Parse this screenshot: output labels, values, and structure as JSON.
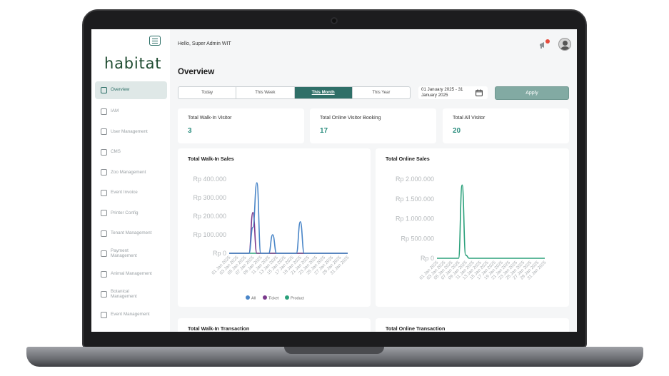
{
  "header": {
    "greeting": "Hello, Super Admin WIT",
    "notification_icon": "megaphone-icon",
    "avatar_icon": "user-avatar-icon"
  },
  "sidebar": {
    "logo": "habitat",
    "items": [
      {
        "label": "Overview",
        "icon": "grid-icon",
        "active": true
      },
      {
        "label": "IAM",
        "icon": "user-key-icon"
      },
      {
        "label": "User Management",
        "icon": "users-icon"
      },
      {
        "label": "CMS",
        "icon": "document-icon"
      },
      {
        "label": "Zoo Management",
        "icon": "paw-icon"
      },
      {
        "label": "Event Invoice",
        "icon": "invoice-icon"
      },
      {
        "label": "Printer Config",
        "icon": "printer-icon"
      },
      {
        "label": "Tenant Management",
        "icon": "store-icon"
      },
      {
        "label": "Payment Management",
        "icon": "wallet-icon"
      },
      {
        "label": "Animal Management",
        "icon": "animal-icon"
      },
      {
        "label": "Botanical Management",
        "icon": "plant-icon"
      },
      {
        "label": "Event Management",
        "icon": "ticket-icon"
      }
    ]
  },
  "main": {
    "title": "Overview",
    "filters": [
      "Today",
      "This Week",
      "This Month",
      "This Year"
    ],
    "active_filter": "This Month",
    "date_range": "01 January 2025 - 31 January 2025",
    "apply_label": "Apply"
  },
  "stats": [
    {
      "label": "Total Walk-In Visitor",
      "value": "3"
    },
    {
      "label": "Total Online Visitor Booking",
      "value": "17"
    },
    {
      "label": "Total All Visitor",
      "value": "20"
    }
  ],
  "colors": {
    "accent": "#2f6f68",
    "value_green": "#2e8f80",
    "all": "#4a86c8",
    "ticket": "#7b3a8c",
    "product": "#2aa07a"
  },
  "chart_data": [
    {
      "type": "line",
      "title": "Total Walk-In Sales",
      "x": [
        "01 Jan 2025",
        "03 Jan 2025",
        "05 Jan 2025",
        "07 Jan 2025",
        "09 Jan 2025",
        "11 Jan 2025",
        "13 Jan 2025",
        "15 Jan 2025",
        "17 Jan 2025",
        "19 Jan 2025",
        "21 Jan 2025",
        "23 Jan 2025",
        "25 Jan 2025",
        "27 Jan 2025",
        "29 Jan 2025",
        "31 Jan 2025"
      ],
      "y_ticks": [
        "Rp 400.000",
        "Rp 300.000",
        "Rp 200.000",
        "Rp 100.000",
        "Rp 0"
      ],
      "ylim": [
        0,
        400000
      ],
      "series": [
        {
          "name": "All",
          "color": "#4a86c8",
          "values": [
            0,
            0,
            0,
            0,
            0,
            0,
            140000,
            380000,
            0,
            0,
            0,
            100000,
            0,
            0,
            0,
            0,
            0,
            0,
            170000,
            0,
            0,
            0,
            0,
            0,
            0,
            0,
            0,
            0,
            0,
            0,
            0
          ]
        },
        {
          "name": "Ticket",
          "color": "#7b3a8c",
          "values": [
            0,
            0,
            0,
            0,
            0,
            0,
            220000,
            0,
            0,
            0,
            0,
            0,
            0,
            0,
            0,
            0,
            0,
            0,
            0,
            0,
            0,
            0,
            0,
            0,
            0,
            0,
            0,
            0,
            0,
            0,
            0
          ]
        },
        {
          "name": "Product",
          "color": "#2aa07a",
          "values": [
            0,
            0,
            0,
            0,
            0,
            0,
            0,
            0,
            0,
            0,
            0,
            0,
            0,
            0,
            0,
            0,
            0,
            0,
            0,
            0,
            0,
            0,
            0,
            0,
            0,
            0,
            0,
            0,
            0,
            0,
            0
          ]
        }
      ],
      "legend": "bottom"
    },
    {
      "type": "line",
      "title": "Total Online Sales",
      "x": [
        "01 Jan 2025",
        "03 Jan 2025",
        "05 Jan 2025",
        "07 Jan 2025",
        "09 Jan 2025",
        "11 Jan 2025",
        "13 Jan 2025",
        "15 Jan 2025",
        "17 Jan 2025",
        "19 Jan 2025",
        "21 Jan 2025",
        "23 Jan 2025",
        "25 Jan 2025",
        "27 Jan 2025",
        "29 Jan 2025",
        "31 Jan 2025"
      ],
      "y_ticks": [
        "Rp 2.000.000",
        "Rp 1.500.000",
        "Rp 1.000.000",
        "Rp 500.000",
        "Rp 0"
      ],
      "ylim": [
        0,
        2000000
      ],
      "series": [
        {
          "color": "#2aa07a",
          "values": [
            0,
            0,
            0,
            0,
            0,
            0,
            0,
            1850000,
            80000,
            0,
            0,
            0,
            0,
            0,
            0,
            0,
            0,
            0,
            0,
            0,
            0,
            0,
            0,
            0,
            0,
            0,
            0,
            0,
            0,
            0,
            0
          ]
        }
      ]
    }
  ],
  "bottom_cards": [
    "Total Walk-In Transaction",
    "Total Online Transaction"
  ]
}
